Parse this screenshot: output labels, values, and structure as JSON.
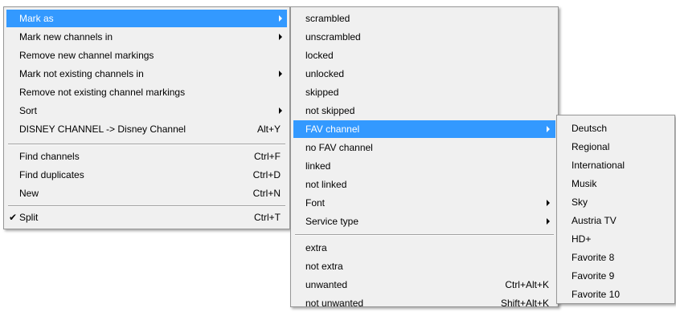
{
  "colors": {
    "menu_background": "#f0f0f0",
    "highlight": "#3399ff",
    "border": "#979797"
  },
  "main_menu": {
    "items": [
      {
        "label": "Mark as",
        "shortcut": "",
        "submenu": true,
        "highlighted": true
      },
      {
        "label": "Mark new channels in",
        "shortcut": "",
        "submenu": true
      },
      {
        "label": "Remove new channel markings",
        "shortcut": ""
      },
      {
        "label": "Mark not existing channels in",
        "shortcut": "",
        "submenu": true
      },
      {
        "label": "Remove not existing channel markings",
        "shortcut": ""
      },
      {
        "label": "Sort",
        "shortcut": "",
        "submenu": true
      },
      {
        "label": "DISNEY CHANNEL -> Disney Channel",
        "shortcut": "Alt+Y"
      },
      {
        "label": "Find channels",
        "shortcut": "Ctrl+F"
      },
      {
        "label": "Find duplicates",
        "shortcut": "Ctrl+D"
      },
      {
        "label": "New",
        "shortcut": "Ctrl+N"
      },
      {
        "label": "Split",
        "shortcut": "Ctrl+T",
        "checked": true
      }
    ],
    "check_glyph": "✔"
  },
  "mark_as_menu": {
    "items": [
      {
        "label": "scrambled",
        "shortcut": ""
      },
      {
        "label": "unscrambled",
        "shortcut": ""
      },
      {
        "label": "locked",
        "shortcut": ""
      },
      {
        "label": "unlocked",
        "shortcut": ""
      },
      {
        "label": "skipped",
        "shortcut": ""
      },
      {
        "label": "not skipped",
        "shortcut": ""
      },
      {
        "label": "FAV channel",
        "shortcut": "",
        "submenu": true,
        "highlighted": true
      },
      {
        "label": "no FAV channel",
        "shortcut": ""
      },
      {
        "label": "linked",
        "shortcut": ""
      },
      {
        "label": "not linked",
        "shortcut": ""
      },
      {
        "label": "Font",
        "shortcut": "",
        "submenu": true
      },
      {
        "label": "Service type",
        "shortcut": "",
        "submenu": true
      },
      {
        "label": "extra",
        "shortcut": ""
      },
      {
        "label": "not extra",
        "shortcut": ""
      },
      {
        "label": "unwanted",
        "shortcut": "Ctrl+Alt+K"
      },
      {
        "label": "not unwanted",
        "shortcut": "Shift+Alt+K"
      }
    ]
  },
  "fav_menu": {
    "items": [
      {
        "label": "Deutsch"
      },
      {
        "label": "Regional"
      },
      {
        "label": "International"
      },
      {
        "label": "Musik"
      },
      {
        "label": "Sky"
      },
      {
        "label": "Austria TV"
      },
      {
        "label": "HD+"
      },
      {
        "label": "Favorite 8"
      },
      {
        "label": "Favorite 9"
      },
      {
        "label": "Favorite 10"
      }
    ]
  }
}
